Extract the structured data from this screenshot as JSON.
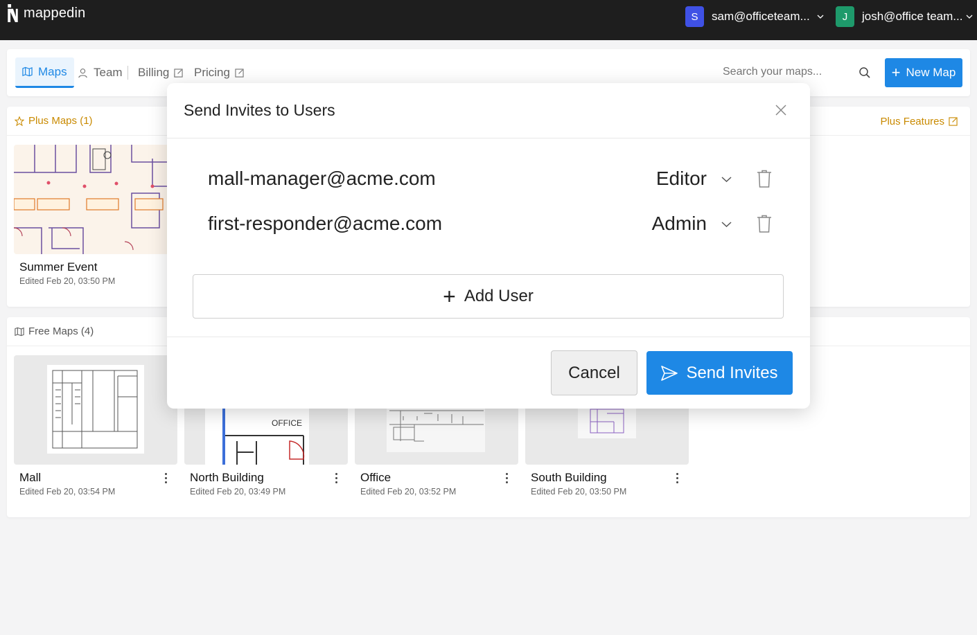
{
  "app": {
    "name": "mappedin"
  },
  "accounts": [
    {
      "initial": "S",
      "label": "sam@officeteam...",
      "color": "#3f51e5"
    },
    {
      "initial": "J",
      "label": "josh@office team...",
      "color": "#1e9a6b"
    }
  ],
  "nav": {
    "tabs": [
      {
        "label": "Maps",
        "icon": "map-icon",
        "active": true
      },
      {
        "label": "Team",
        "icon": "user-icon"
      },
      {
        "label": "Billing",
        "icon": "external-link-icon"
      },
      {
        "label": "Pricing",
        "icon": "external-link-icon"
      }
    ],
    "search_placeholder": "Search your maps...",
    "new_map_label": "New Map"
  },
  "plus_section": {
    "title": "Plus Maps (1)",
    "features_link": "Plus Features",
    "maps": [
      {
        "title": "Summer Event",
        "edited": "Edited Feb 20, 03:50 PM"
      }
    ]
  },
  "free_section": {
    "title": "Free Maps (4)",
    "maps": [
      {
        "title": "Mall",
        "edited": "Edited Feb 20, 03:54 PM"
      },
      {
        "title": "North Building",
        "edited": "Edited Feb 20, 03:49 PM",
        "thumb_text": "OFFICE"
      },
      {
        "title": "Office",
        "edited": "Edited Feb 20, 03:52 PM"
      },
      {
        "title": "South Building",
        "edited": "Edited Feb 20, 03:50 PM"
      }
    ]
  },
  "modal": {
    "title": "Send Invites to Users",
    "invites": [
      {
        "email": "mall-manager@acme.com",
        "role": "Editor"
      },
      {
        "email": "first-responder@acme.com",
        "role": "Admin"
      }
    ],
    "add_user_label": "Add User",
    "cancel_label": "Cancel",
    "send_label": "Send Invites"
  },
  "colors": {
    "accent": "#1e88e5",
    "plus_gold": "#c98a00",
    "topbar": "#1e1e1e"
  }
}
